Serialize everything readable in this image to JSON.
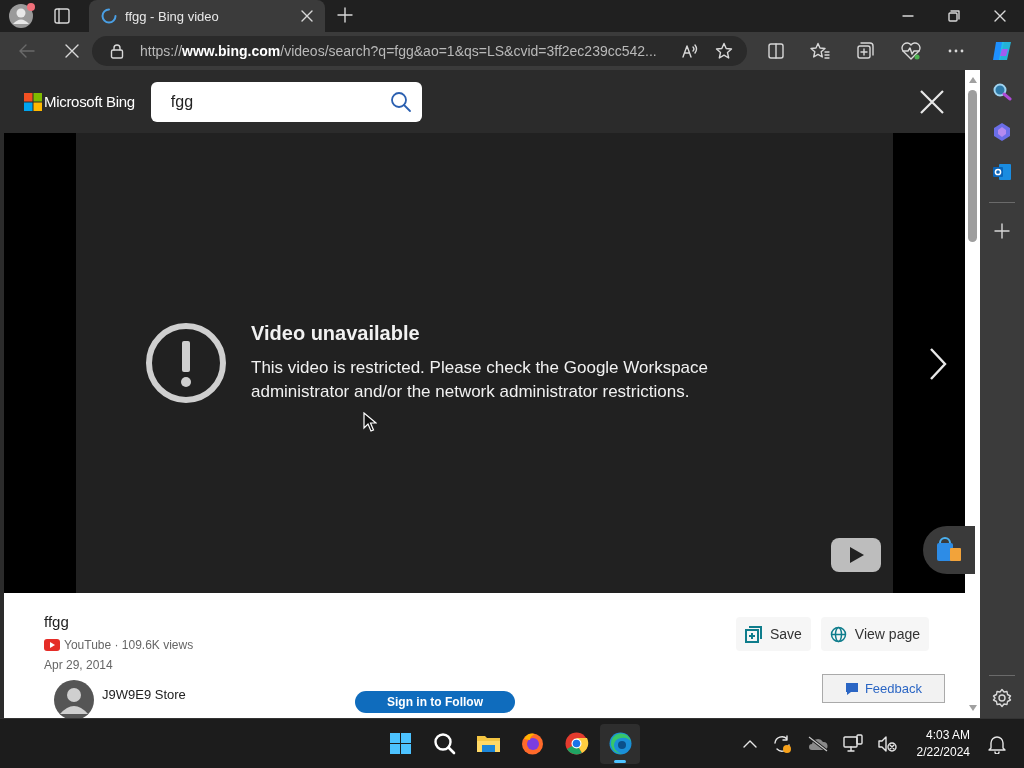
{
  "browser": {
    "tabs": [
      {
        "title": "ffgg - Bing video",
        "selected": true
      }
    ],
    "address": "https://**www.bing.com**/videos/search?q=fgg&ao=1&qs=LS&cvid=3ff2ec239cc542..."
  },
  "header": {
    "brand": "Microsoft Bing",
    "search_value": "fgg"
  },
  "player": {
    "error_title": "Video unavailable",
    "error_message": "This video is restricted. Please check the Google Workspace administrator and/or the network administrator restrictions."
  },
  "video_info": {
    "title": "ffgg",
    "source": "YouTube · 109.6K views",
    "date": "Apr 29, 2014",
    "channel": "J9W9E9 Store",
    "follow_button": "Sign in to Follow",
    "actions": [
      {
        "label": "Save",
        "kind": "save"
      },
      {
        "label": "View page",
        "kind": "web"
      }
    ],
    "feedback": "Feedback"
  },
  "taskbar": {
    "apps": [
      {
        "kind": "start",
        "selected": false
      },
      {
        "kind": "search",
        "selected": false
      },
      {
        "kind": "files",
        "selected": false
      },
      {
        "kind": "firefox",
        "selected": false
      },
      {
        "kind": "chrome",
        "selected": false
      },
      {
        "kind": "edge",
        "selected": true
      }
    ],
    "time": "4:03 AM",
    "date": "2/22/2024"
  }
}
